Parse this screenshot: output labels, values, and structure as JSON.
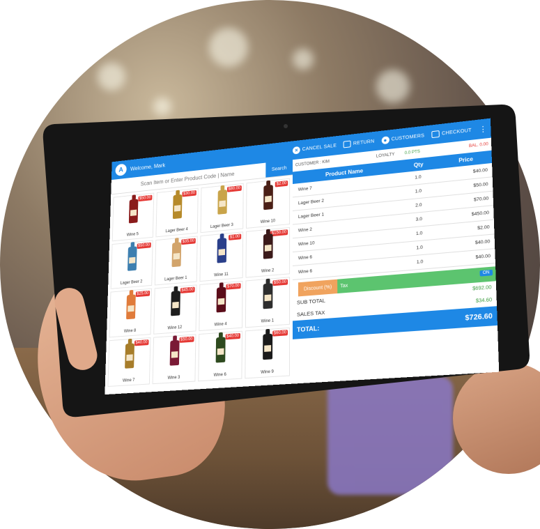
{
  "header": {
    "welcome": "Welcome, Mark",
    "cancel_sale": "CANCEL SALE",
    "return": "RETURN",
    "customers": "CUSTOMERS",
    "checkout": "CHECKOUT",
    "logo_letter": "A"
  },
  "search": {
    "placeholder": "Scan Item or Enter Product Code | Name",
    "button": "Search"
  },
  "products": [
    {
      "name": "Wine 5",
      "price": "$50.00",
      "color": "#8a1b1b"
    },
    {
      "name": "Lager Beer 4",
      "price": "$30.00",
      "color": "#b68a2a"
    },
    {
      "name": "Lager Beer 3",
      "price": "$80.00",
      "color": "#c9a44a"
    },
    {
      "name": "Wine 10",
      "price": "$2.00",
      "color": "#4a1f16"
    },
    {
      "name": "Lager Beer 2",
      "price": "$50.00",
      "color": "#3d7fb0"
    },
    {
      "name": "Lager Beer 1",
      "price": "$35.00",
      "color": "#d2a46b"
    },
    {
      "name": "Wine 11",
      "price": "$1.00",
      "color": "#2a3f8a"
    },
    {
      "name": "Wine 2",
      "price": "$150.00",
      "color": "#3b1a1a"
    },
    {
      "name": "Wine 8",
      "price": "$25.00",
      "color": "#e07b3a"
    },
    {
      "name": "Wine 12",
      "price": "$45.00",
      "color": "#1d1d1d"
    },
    {
      "name": "Wine 4",
      "price": "$70.00",
      "color": "#5b0d1a"
    },
    {
      "name": "Wine 1",
      "price": "$50.00",
      "color": "#2d2d2d"
    },
    {
      "name": "Wine 7",
      "price": "$40.00",
      "color": "#a77d2a"
    },
    {
      "name": "Wine 3",
      "price": "$50.00",
      "color": "#7a1a35"
    },
    {
      "name": "Wine 6",
      "price": "$40.00",
      "color": "#2e4a1f"
    },
    {
      "name": "Wine 9",
      "price": "$60.00",
      "color": "#1a1a1a"
    }
  ],
  "customer": {
    "label": "CUSTOMER : KIM",
    "loyalty_label": "LOYALTY",
    "points": "0.0 PTS",
    "balance": "BAL. 0.00"
  },
  "cart": {
    "col_name": "Product Name",
    "col_qty": "Qty",
    "col_price": "Price",
    "rows": [
      {
        "name": "Wine 7",
        "qty": "1.0",
        "price": "$40.00"
      },
      {
        "name": "Lager Beer 2",
        "qty": "1.0",
        "price": "$50.00"
      },
      {
        "name": "Lager Beer 1",
        "qty": "2.0",
        "price": "$70.00"
      },
      {
        "name": "Wine 2",
        "qty": "3.0",
        "price": "$450.00"
      },
      {
        "name": "Wine 10",
        "qty": "1.0",
        "price": "$2.00"
      },
      {
        "name": "Wine 6",
        "qty": "1.0",
        "price": "$40.00"
      },
      {
        "name": "Wine 6",
        "qty": "1.0",
        "price": "$40.00"
      }
    ]
  },
  "totals": {
    "discount": "Discount (%)",
    "tax": "Tax",
    "toggle": "ON",
    "subtotal_label": "SUB TOTAL",
    "subtotal": "$692.00",
    "sales_tax_label": "SALES TAX",
    "sales_tax": "$34.60",
    "total_label": "TOTAL:",
    "total": "$726.60"
  }
}
